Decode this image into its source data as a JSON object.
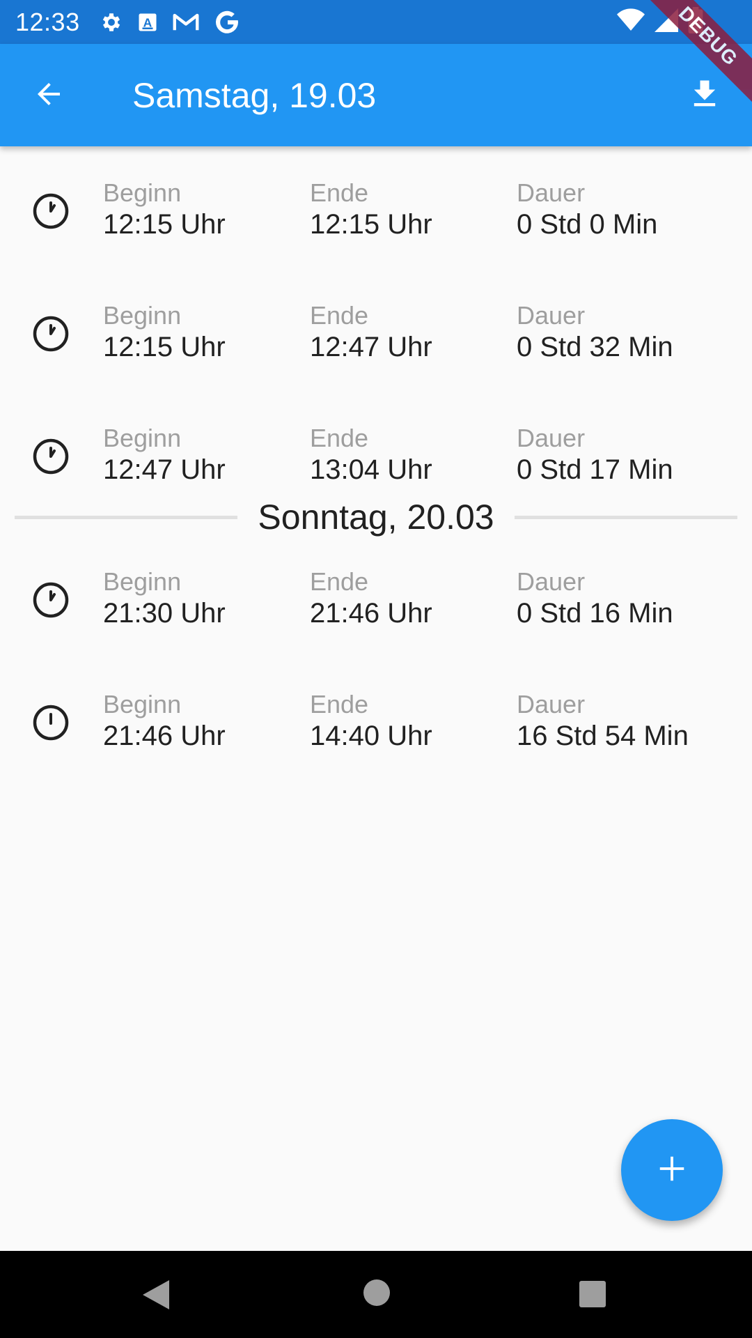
{
  "status_bar": {
    "time": "12:33",
    "icons": [
      "settings-icon",
      "a-box-icon",
      "gmail-icon",
      "google-icon",
      "wifi-icon",
      "signal-icon",
      "battery-icon"
    ]
  },
  "app_bar": {
    "title": "Samstag, 19.03",
    "back_icon": "arrow-back-icon",
    "action_icon": "download-icon",
    "background": "#2196f3"
  },
  "debug_banner": "DEBUG",
  "groups": [
    {
      "day": "",
      "entries": [
        {
          "begin_label": "Beginn",
          "begin": "12:15 Uhr",
          "end_label": "Ende",
          "end": "12:15 Uhr",
          "duration_label": "Dauer",
          "duration": "0 Std 0 Min"
        },
        {
          "begin_label": "Beginn",
          "begin": "12:15 Uhr",
          "end_label": "Ende",
          "end": "12:47 Uhr",
          "duration_label": "Dauer",
          "duration": "0 Std 32 Min"
        },
        {
          "begin_label": "Beginn",
          "begin": "12:47 Uhr",
          "end_label": "Ende",
          "end": "13:04 Uhr",
          "duration_label": "Dauer",
          "duration": "0 Std 17 Min"
        }
      ]
    },
    {
      "day": "Sonntag, 20.03",
      "entries": [
        {
          "begin_label": "Beginn",
          "begin": "21:30 Uhr",
          "end_label": "Ende",
          "end": "21:46 Uhr",
          "duration_label": "Dauer",
          "duration": "0 Std 16 Min"
        },
        {
          "begin_label": "Beginn",
          "begin": "21:46 Uhr",
          "end_label": "Ende",
          "end": "14:40 Uhr",
          "duration_label": "Dauer",
          "duration": "16 Std 54 Min"
        }
      ]
    }
  ],
  "fab": {
    "icon": "add-icon",
    "color": "#2196f3"
  },
  "nav_bar": {
    "icons": [
      "nav-back-icon",
      "nav-home-icon",
      "nav-recents-icon"
    ]
  }
}
